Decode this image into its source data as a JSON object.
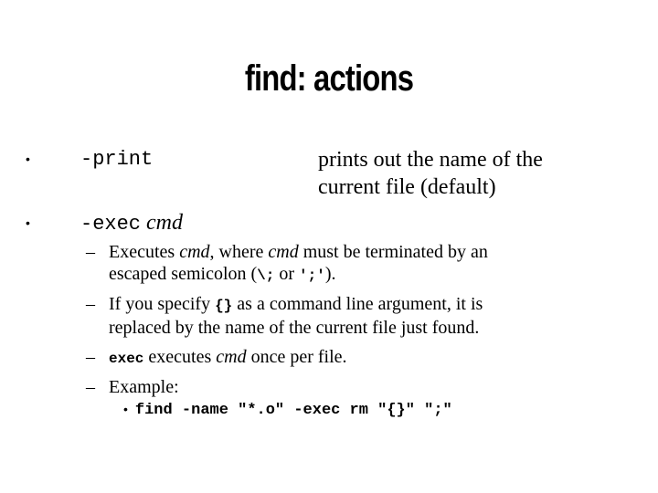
{
  "slide": {
    "title": "find: actions",
    "bullets": [
      {
        "option": "-print",
        "description_lines": [
          "prints out the name of the",
          "current file (default)"
        ]
      },
      {
        "option": "-exec",
        "argument": "cmd"
      }
    ],
    "sub_bullets": {
      "item1": {
        "p1": "Executes ",
        "i1": "cmd",
        "p2": ", where ",
        "i2": "cmd",
        "p3": " must be terminated by an",
        "p4": "escaped semicolon (",
        "c1": "\\;",
        "p5": " or ",
        "c2": "';'",
        "p6": ")."
      },
      "item2": {
        "p1": "If you specify ",
        "c1": "{}",
        "p2": " as a command line argument, it is",
        "p3": "replaced by the name of the current file just found."
      },
      "item3": {
        "c1": "exec",
        "p1": " executes ",
        "i1": "cmd",
        "p2": " once per file."
      },
      "item4": {
        "p1": "Example:"
      }
    },
    "example_command": "find -name \"*.o\" -exec rm \"{}\" \";\"",
    "bullet_glyph": "•",
    "dash_glyph": "–"
  }
}
